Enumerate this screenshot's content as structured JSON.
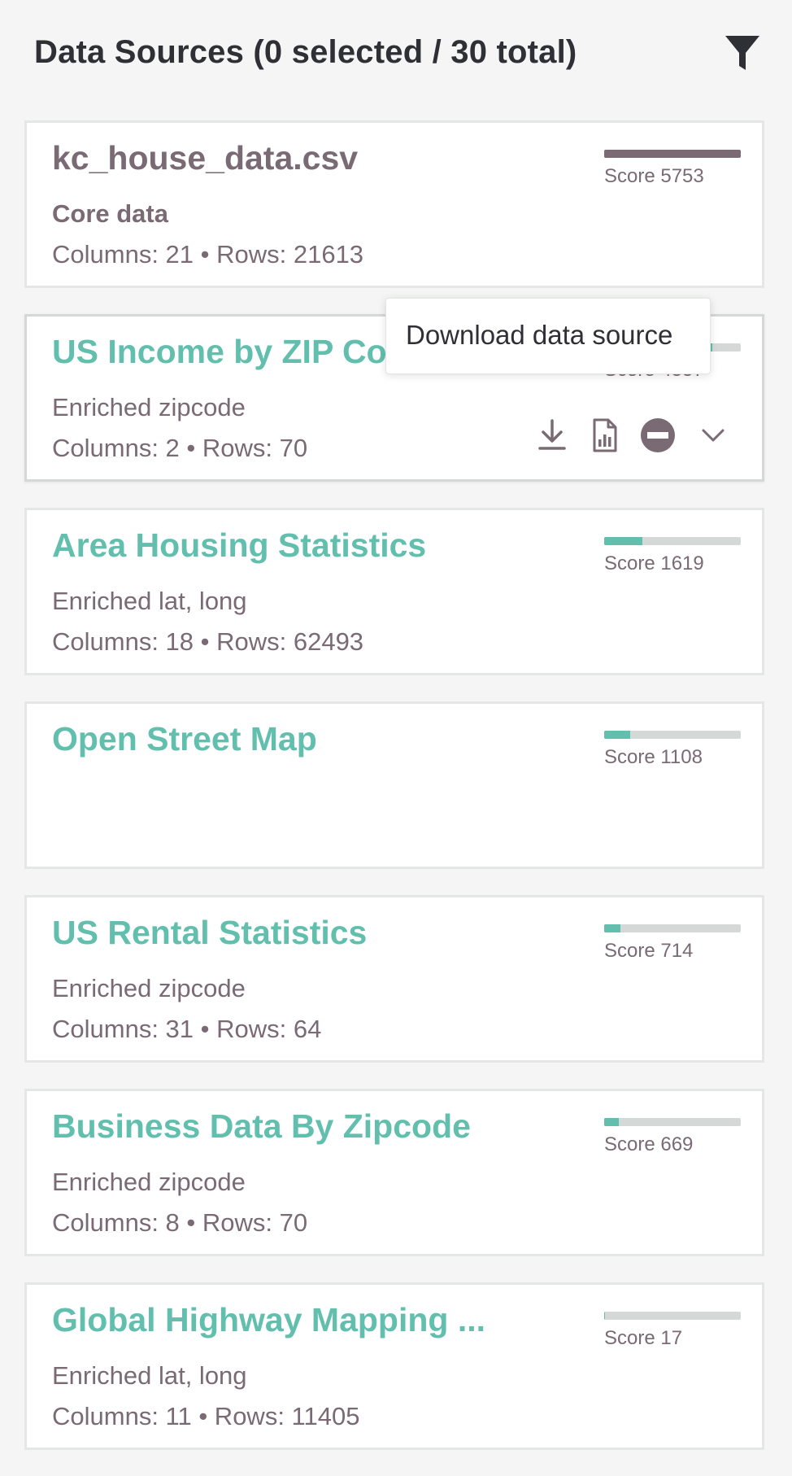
{
  "header": {
    "title": "Data Sources (0 selected / 30 total)",
    "filter_icon": "filter-icon"
  },
  "tooltip": {
    "text": "Download data source"
  },
  "sources": [
    {
      "title": "kc_house_data.csv",
      "subtitle": "Core data",
      "meta": "Columns: 21 • Rows: 21613",
      "score_label": "Score 5753",
      "score_fraction": 1.0,
      "style": "core"
    },
    {
      "title": "US Income by ZIP Code",
      "subtitle": "Enriched zipcode",
      "meta": "Columns: 2 • Rows: 70",
      "score_label": "Score 4557",
      "score_fraction": 0.79,
      "style": "enriched",
      "hovered": true,
      "actions": [
        {
          "icon": "download-icon"
        },
        {
          "icon": "report-icon"
        },
        {
          "icon": "remove-icon"
        },
        {
          "icon": "chevron-down-icon"
        }
      ]
    },
    {
      "title": "Area Housing Statistics",
      "subtitle": "Enriched lat, long",
      "meta": "Columns: 18 • Rows: 62493",
      "score_label": "Score 1619",
      "score_fraction": 0.28,
      "style": "enriched"
    },
    {
      "title": "Open Street Map",
      "subtitle": "",
      "meta": "",
      "score_label": "Score 1108",
      "score_fraction": 0.19,
      "style": "enriched"
    },
    {
      "title": "US Rental Statistics",
      "subtitle": "Enriched zipcode",
      "meta": "Columns: 31 • Rows: 64",
      "score_label": "Score 714",
      "score_fraction": 0.12,
      "style": "enriched"
    },
    {
      "title": "Business Data By Zipcode",
      "subtitle": "Enriched zipcode",
      "meta": "Columns: 8 • Rows: 70",
      "score_label": "Score 669",
      "score_fraction": 0.11,
      "style": "enriched"
    },
    {
      "title": "Global Highway Mapping ...",
      "subtitle": "Enriched lat, long",
      "meta": "Columns: 11 • Rows: 11405",
      "score_label": "Score 17",
      "score_fraction": 0.003,
      "style": "enriched"
    }
  ],
  "colors": {
    "accent": "#62bfae",
    "core": "#7a6a74",
    "text_dark": "#2f2f36",
    "bar_track": "#d4d9d7"
  }
}
